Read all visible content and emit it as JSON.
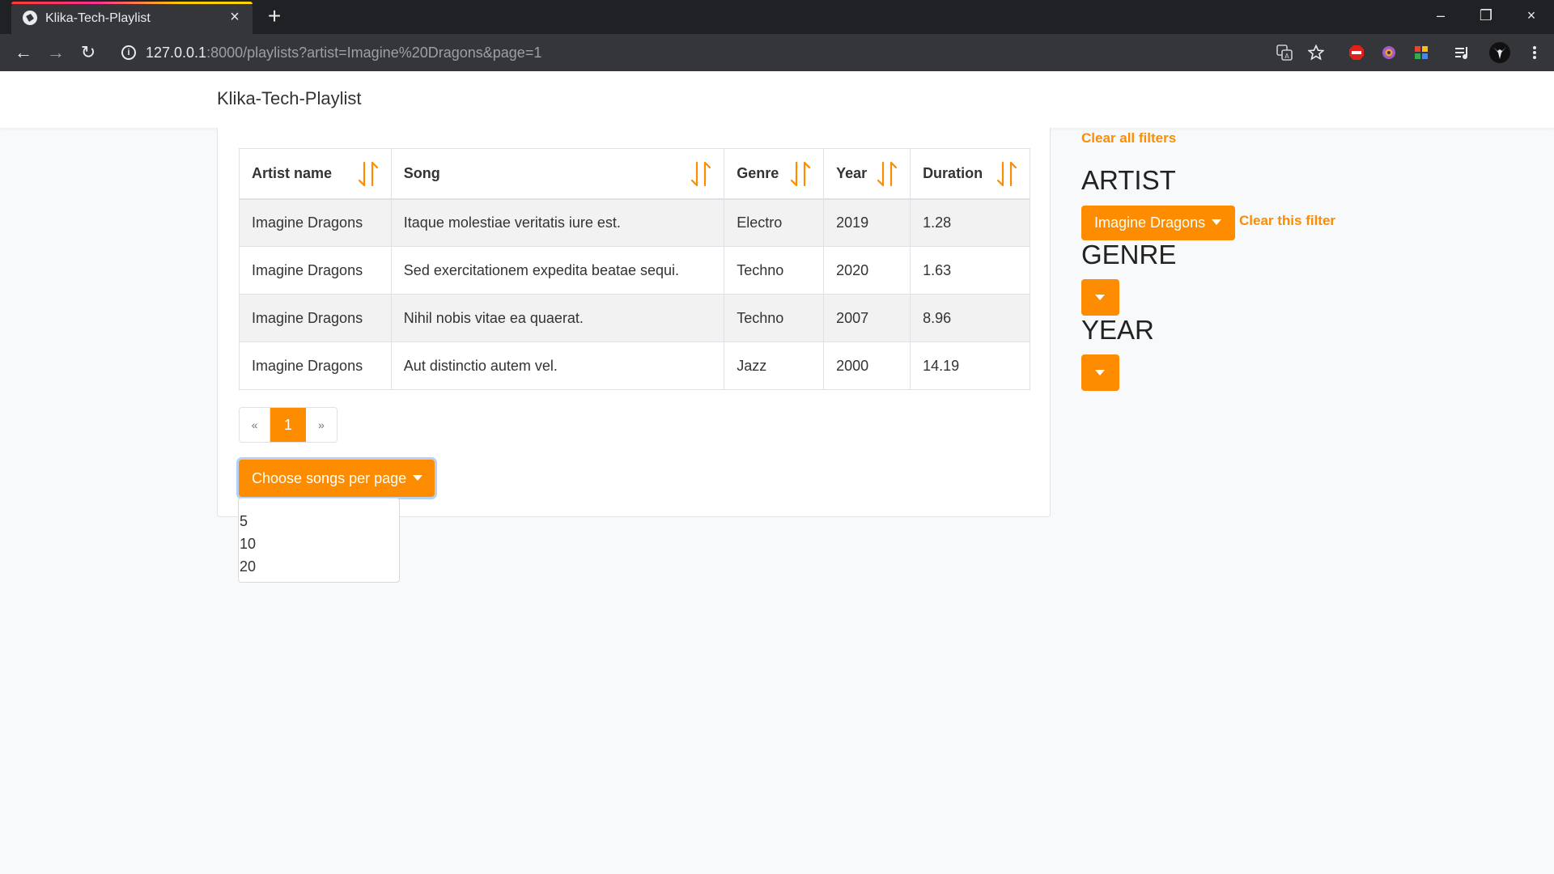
{
  "browser": {
    "tab_title": "Klika-Tech-Playlist",
    "url_host": "127.0.0.1",
    "url_rest": ":8000/playlists?artist=Imagine%20Dragons&page=1"
  },
  "navbar": {
    "brand": "Klika-Tech-Playlist"
  },
  "table": {
    "headers": [
      "Artist name",
      "Song",
      "Genre",
      "Year",
      "Duration"
    ],
    "rows": [
      [
        "Imagine Dragons",
        "Itaque molestiae veritatis iure est.",
        "Electro",
        "2019",
        "1.28"
      ],
      [
        "Imagine Dragons",
        "Sed exercitationem expedita beatae sequi.",
        "Techno",
        "2020",
        "1.63"
      ],
      [
        "Imagine Dragons",
        "Nihil nobis vitae ea quaerat.",
        "Techno",
        "2007",
        "8.96"
      ],
      [
        "Imagine Dragons",
        "Aut distinctio autem vel.",
        "Jazz",
        "2000",
        "14.19"
      ]
    ]
  },
  "pagination": {
    "prev": "«",
    "current": "1",
    "next": "»"
  },
  "per_page": {
    "button_label": "Choose songs per page",
    "options": [
      "5",
      "10",
      "20"
    ]
  },
  "filters": {
    "clear_all": "Clear all filters",
    "artist_heading": "ARTIST",
    "artist_selected": "Imagine Dragons",
    "clear_this": "Clear this filter",
    "genre_heading": "GENRE",
    "year_heading": "YEAR"
  },
  "colors": {
    "accent": "#fd8c00"
  }
}
